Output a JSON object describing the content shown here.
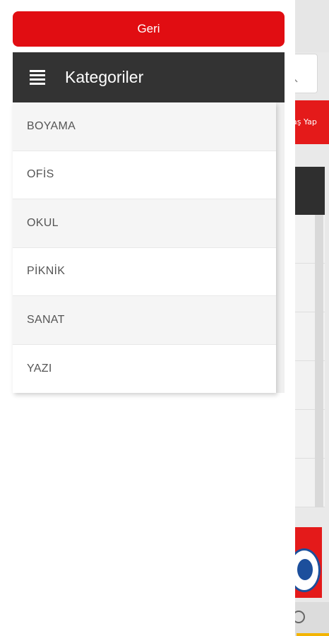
{
  "drawer": {
    "back_label": "Geri",
    "header_title": "Kategoriler",
    "categories": [
      {
        "label": "BOYAMA"
      },
      {
        "label": "OFİS"
      },
      {
        "label": "OKUL"
      },
      {
        "label": "PİKNİK"
      },
      {
        "label": "SANAT"
      },
      {
        "label": "YAZI"
      }
    ]
  },
  "background": {
    "login_label": "aş Yap"
  },
  "colors": {
    "accent_red": "#e10d12",
    "header_dark": "#333333",
    "footer_accent": "#f3b400",
    "badge_blue": "#1c4f9c"
  },
  "icons": {
    "menu": "hamburger-menu-icon",
    "search": "search-icon",
    "footer": "user-icon"
  }
}
